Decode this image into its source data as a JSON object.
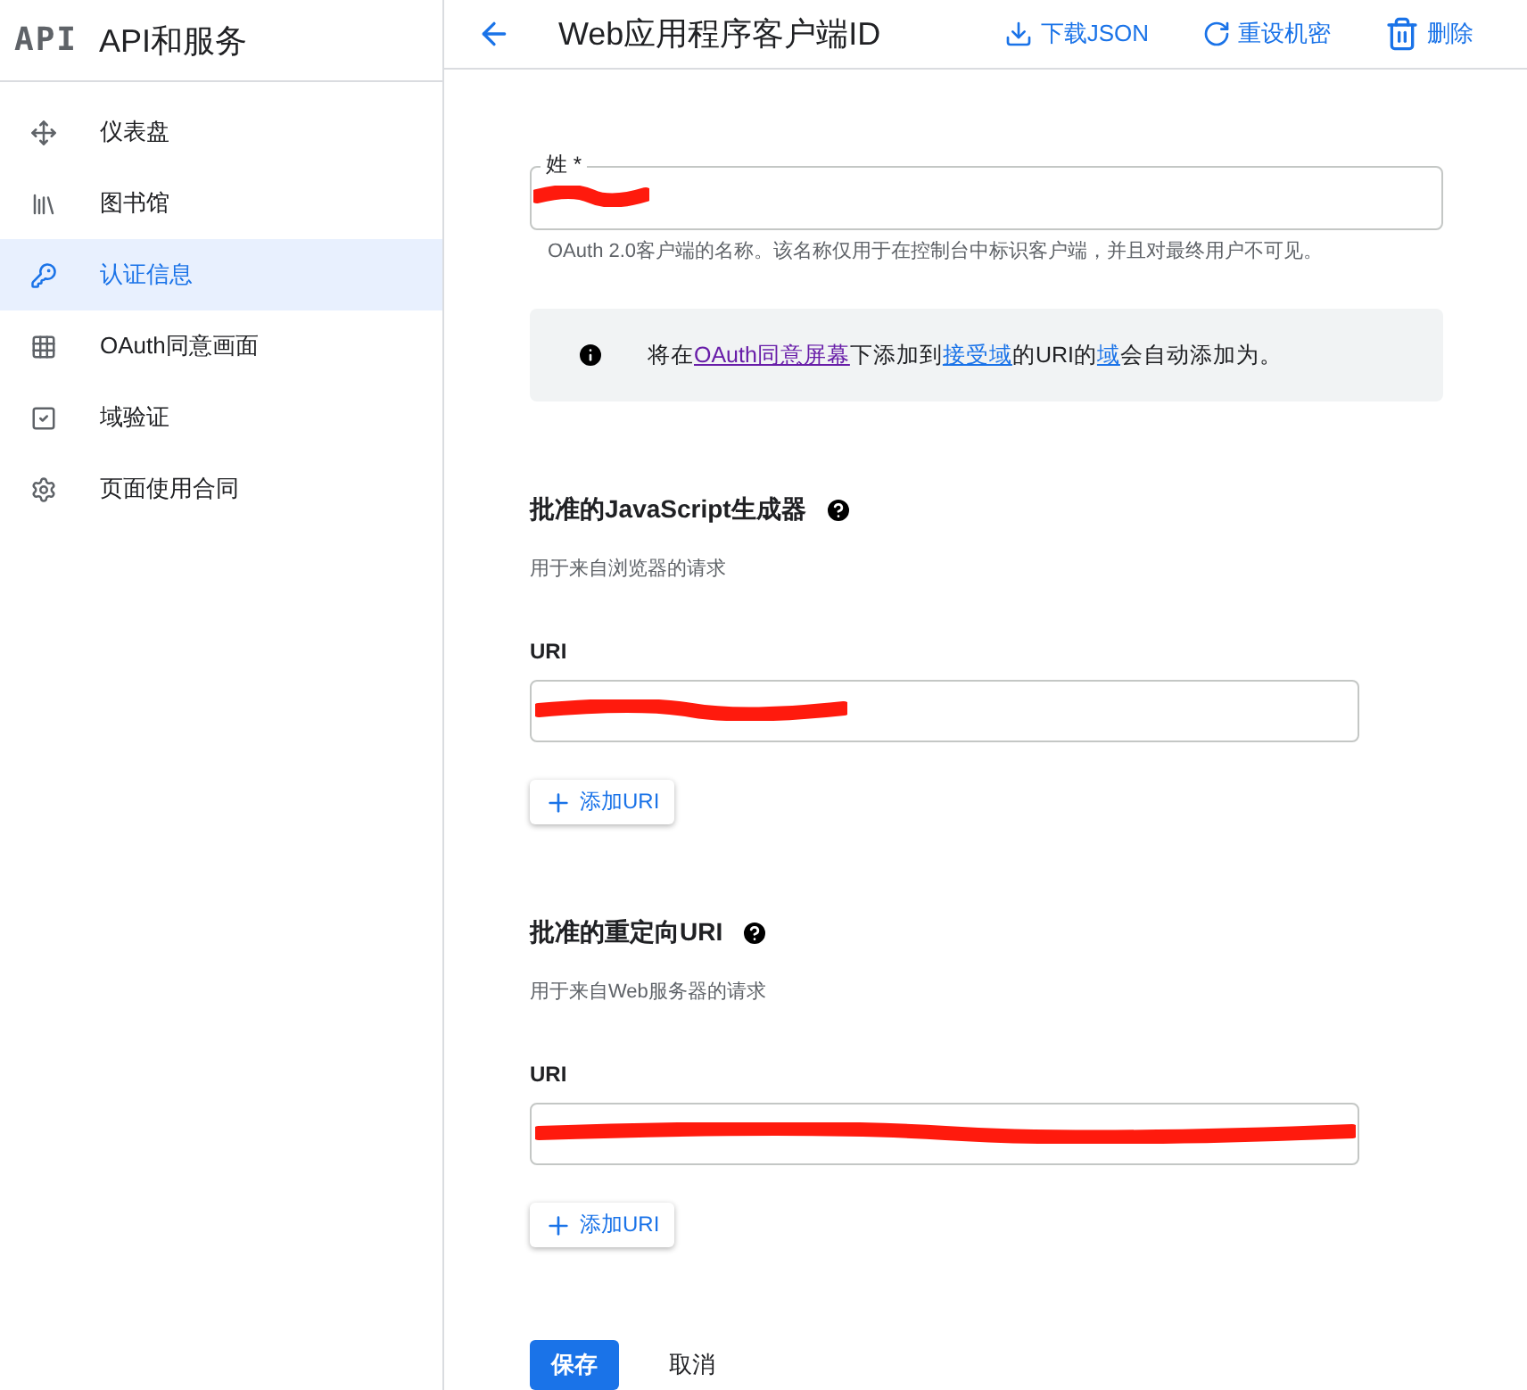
{
  "sidebar": {
    "logo_text": "API",
    "title": "API和服务",
    "items": [
      {
        "label": "仪表盘",
        "selected": false
      },
      {
        "label": "图书馆",
        "selected": false
      },
      {
        "label": "认证信息",
        "selected": true
      },
      {
        "label": "OAuth同意画面",
        "selected": false
      },
      {
        "label": "域验证",
        "selected": false
      },
      {
        "label": "页面使用合同",
        "selected": false
      }
    ]
  },
  "header": {
    "title": "Web应用程序客户端ID",
    "actions": [
      {
        "label": "下载JSON"
      },
      {
        "label": "重设机密"
      },
      {
        "label": "删除"
      }
    ]
  },
  "name_field": {
    "label": "姓 *",
    "redacted": true,
    "hint": "OAuth 2.0客户端的名称。该名称仅用于在控制台中标识客户端，并且对最终用户不可见。"
  },
  "notice": [
    {
      "text": "将在",
      "link": false
    },
    {
      "text": "OAuth同意屏幕",
      "link": true,
      "visited": true
    },
    {
      "text": "下添加到",
      "link": false
    },
    {
      "text": "接受域",
      "link": true,
      "visited": false
    },
    {
      "text": "的URI的",
      "link": false
    },
    {
      "text": "域",
      "link": true,
      "visited": false
    },
    {
      "text": "会自动添加为。",
      "link": false
    }
  ],
  "sections": [
    {
      "title": "批准的JavaScript生成器",
      "subtitle": "用于来自浏览器的请求",
      "uri_label": "URI",
      "redacted": true,
      "add_label": "添加URI"
    },
    {
      "title": "批准的重定向URI",
      "subtitle": "用于来自Web服务器的请求",
      "uri_label": "URI",
      "redacted": true,
      "add_label": "添加URI"
    }
  ],
  "buttons": {
    "save": "保存",
    "cancel": "取消"
  }
}
